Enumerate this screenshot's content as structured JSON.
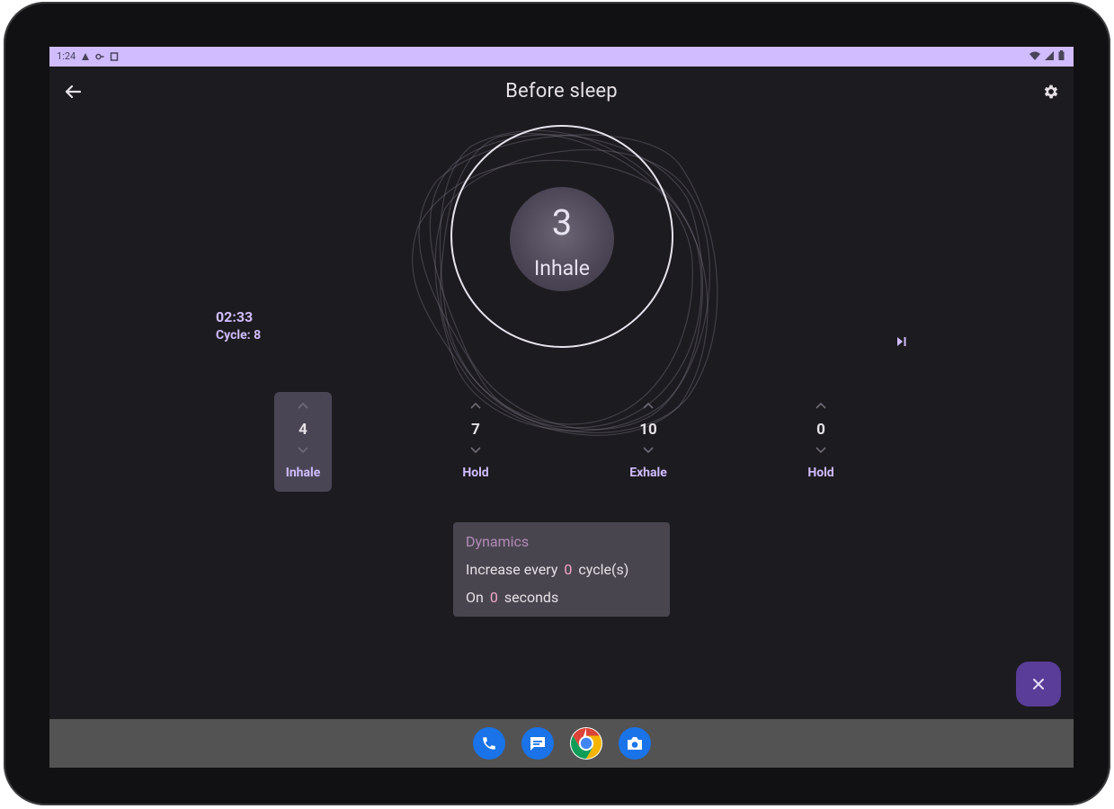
{
  "status_bar": {
    "time": "1:24"
  },
  "app_bar": {
    "title": "Before sleep"
  },
  "breath": {
    "count": "3",
    "phase": "Inhale"
  },
  "session": {
    "elapsed": "02:33",
    "cycle": "Cycle: 8"
  },
  "steps": [
    {
      "value": "4",
      "label": "Inhale",
      "active": true
    },
    {
      "value": "7",
      "label": "Hold",
      "active": false
    },
    {
      "value": "10",
      "label": "Exhale",
      "active": false
    },
    {
      "value": "0",
      "label": "Hold",
      "active": false
    }
  ],
  "dynamics": {
    "title": "Dynamics",
    "increase_prefix": "Increase every",
    "increase_value": "0",
    "increase_suffix": "cycle(s)",
    "on_prefix": "On",
    "on_value": "0",
    "on_suffix": "seconds"
  },
  "dock_icons": [
    "phone-icon",
    "messages-icon",
    "chrome-icon",
    "camera-icon"
  ],
  "colors": {
    "accent": "#d0bcff",
    "fab": "#5a3d98",
    "highlight": "#f2a7c8",
    "surface": "#1c1b1f"
  }
}
